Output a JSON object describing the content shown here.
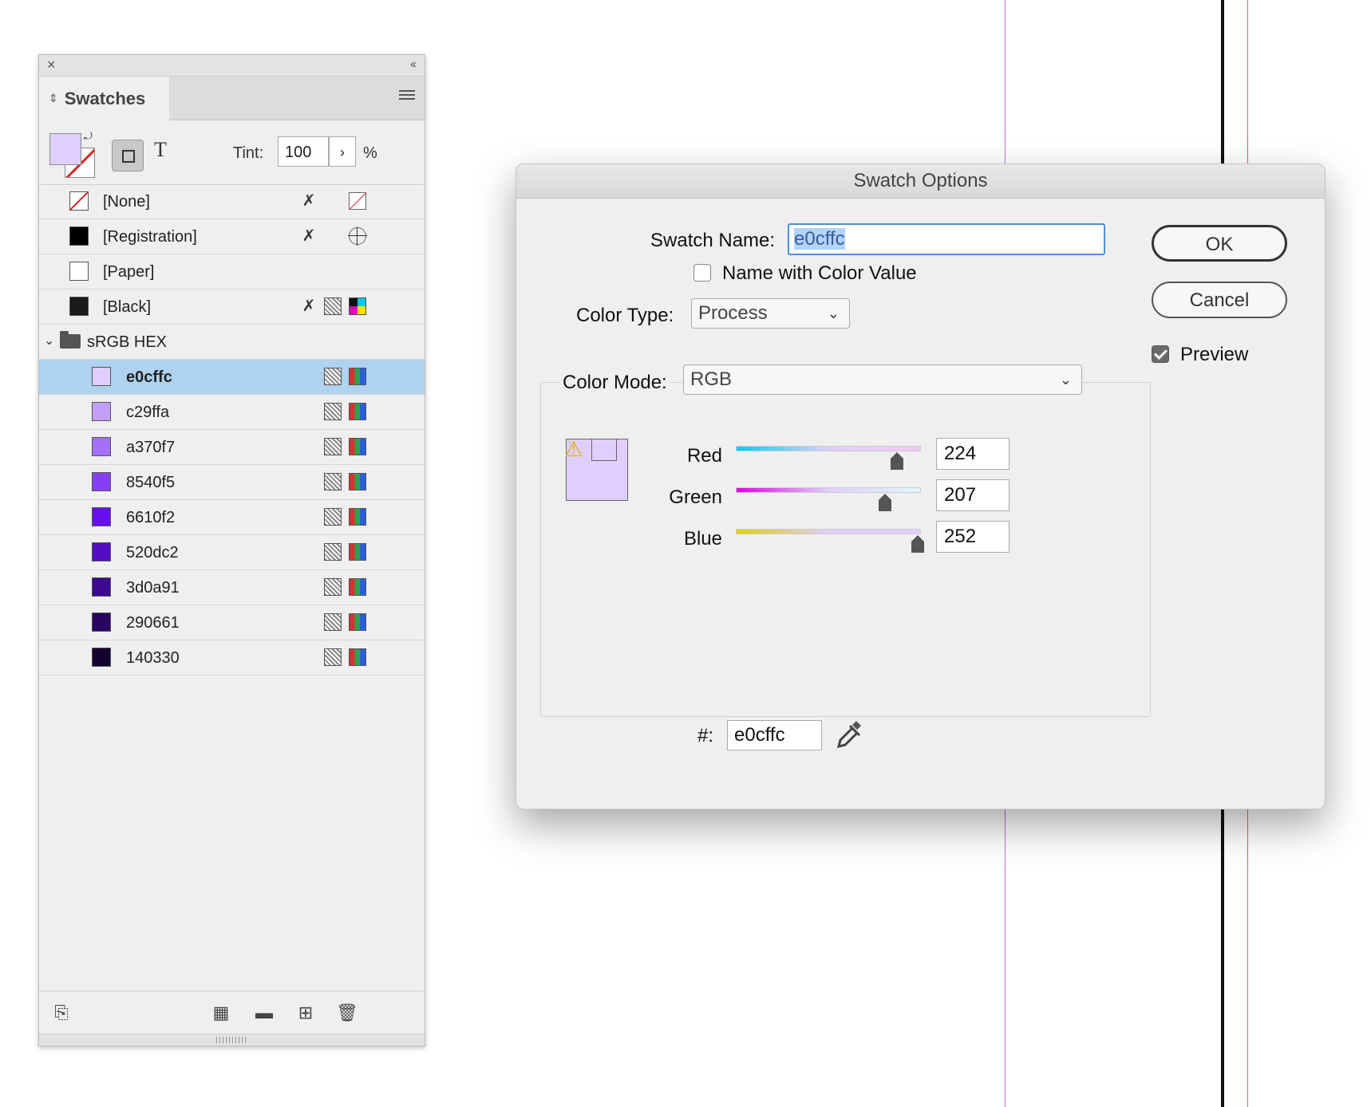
{
  "panel": {
    "close_glyph": "×",
    "collapse_glyph": "‹‹",
    "tab_label": "Swatches",
    "tint_label": "Tint:",
    "tint_value": "100",
    "tint_arrow": "›",
    "tint_unit": "%",
    "text_glyph": "T",
    "fill_color": "#e0cffc",
    "system_swatches": [
      {
        "label": "[None]"
      },
      {
        "label": "[Registration]"
      },
      {
        "label": "[Paper]"
      },
      {
        "label": "[Black]"
      }
    ],
    "group": {
      "label": "sRGB HEX"
    },
    "swatches": [
      {
        "label": "e0cffc",
        "color": "#e0cffc",
        "selected": true
      },
      {
        "label": "c29ffa",
        "color": "#c29ffa"
      },
      {
        "label": "a370f7",
        "color": "#a370f7"
      },
      {
        "label": "8540f5",
        "color": "#8540f5"
      },
      {
        "label": "6610f2",
        "color": "#6610f2"
      },
      {
        "label": "520dc2",
        "color": "#520dc2"
      },
      {
        "label": "3d0a91",
        "color": "#3d0a91"
      },
      {
        "label": "290661",
        "color": "#290661"
      },
      {
        "label": "140330",
        "color": "#140330"
      }
    ]
  },
  "dialog": {
    "title": "Swatch Options",
    "swatch_name_label": "Swatch Name:",
    "swatch_name_value": "e0cffc",
    "name_with_color_value_label": "Name with Color Value",
    "name_with_color_value_checked": false,
    "color_type_label": "Color Type:",
    "color_type_value": "Process",
    "color_mode_label": "Color Mode:",
    "color_mode_value": "RGB",
    "ok_label": "OK",
    "cancel_label": "Cancel",
    "preview_label": "Preview",
    "preview_checked": true,
    "warning_glyph": "⚠",
    "red_label": "Red",
    "green_label": "Green",
    "blue_label": "Blue",
    "red_value": "224",
    "green_value": "207",
    "blue_value": "252",
    "hex_label": "#:",
    "hex_value": "e0cffc",
    "preview_color": "#e0cffc"
  }
}
